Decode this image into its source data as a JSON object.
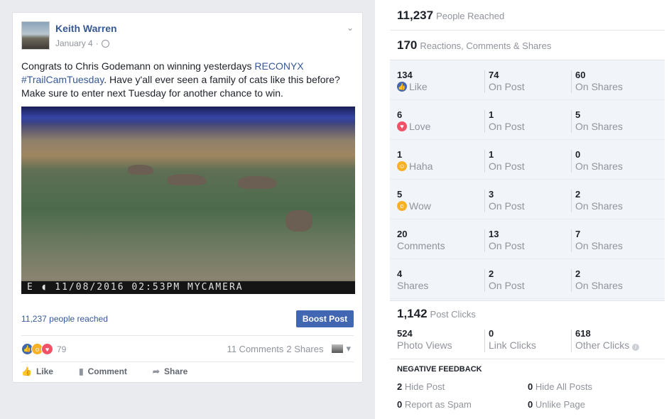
{
  "post": {
    "author": "Keith Warren",
    "date": "January 4",
    "text_pre": "Congrats to Chris Godemann on winning yesterdays ",
    "link1": "RECONYX",
    "link2": "#TrailCamTuesday",
    "text_post": ". Have y'all ever seen a family of cats like this before? Make sure to enter next Tuesday for another chance to win.",
    "photo_stamp": "E ◖ 11/08/2016 02:53PM MYCAMERA",
    "reached": "11,237 people reached",
    "boost_label": "Boost Post",
    "reaction_count": "79",
    "comments": "11 Comments",
    "shares": "2 Shares",
    "actions": {
      "like": "Like",
      "comment": "Comment",
      "share": "Share"
    }
  },
  "insights": {
    "reached_num": "11,237",
    "reached_label": "People Reached",
    "reactions_num": "170",
    "reactions_label": "Reactions, Comments & Shares",
    "rows": [
      {
        "n1": "134",
        "l1": "Like",
        "n2": "74",
        "l2": "On Post",
        "n3": "60",
        "l3": "On Shares",
        "icon": "like-icon",
        "color": "#4267b2"
      },
      {
        "n1": "6",
        "l1": "Love",
        "n2": "1",
        "l2": "On Post",
        "n3": "5",
        "l3": "On Shares",
        "icon": "love-icon",
        "color": "#f25268"
      },
      {
        "n1": "1",
        "l1": "Haha",
        "n2": "1",
        "l2": "On Post",
        "n3": "0",
        "l3": "On Shares",
        "icon": "haha-icon",
        "color": "#f7b125"
      },
      {
        "n1": "5",
        "l1": "Wow",
        "n2": "3",
        "l2": "On Post",
        "n3": "2",
        "l3": "On Shares",
        "icon": "wow-icon",
        "color": "#f7b125"
      },
      {
        "n1": "20",
        "l1": "Comments",
        "n2": "13",
        "l2": "On Post",
        "n3": "7",
        "l3": "On Shares"
      },
      {
        "n1": "4",
        "l1": "Shares",
        "n2": "2",
        "l2": "On Post",
        "n3": "2",
        "l3": "On Shares"
      }
    ],
    "clicks_num": "1,142",
    "clicks_label": "Post Clicks",
    "clicks": [
      {
        "n": "524",
        "l": "Photo Views"
      },
      {
        "n": "0",
        "l": "Link Clicks"
      },
      {
        "n": "618",
        "l": "Other Clicks"
      }
    ],
    "negative_title": "NEGATIVE FEEDBACK",
    "negative": [
      {
        "n": "2",
        "l": "Hide Post"
      },
      {
        "n": "0",
        "l": "Hide All Posts"
      },
      {
        "n": "0",
        "l": "Report as Spam"
      },
      {
        "n": "0",
        "l": "Unlike Page"
      }
    ]
  }
}
